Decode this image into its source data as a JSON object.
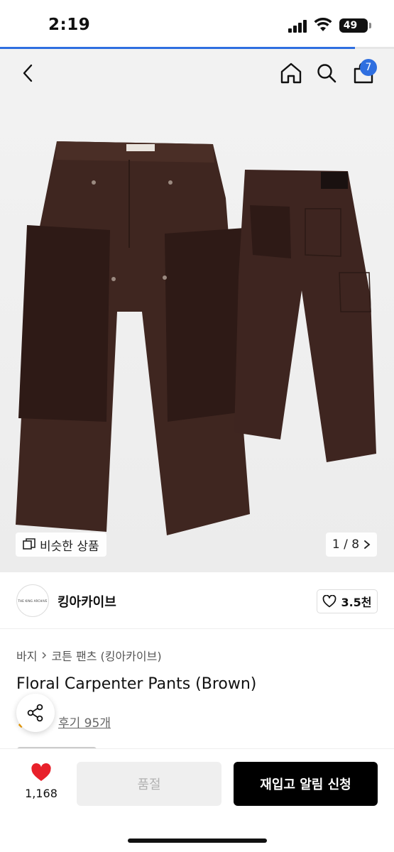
{
  "status_bar": {
    "time": "2:19",
    "battery": "49",
    "page_load_progress": 0.9
  },
  "nav": {
    "back_icon": "chevron-left-icon",
    "home_icon": "home-icon",
    "search_icon": "search-icon",
    "cart_icon": "shopping-bag-icon",
    "cart_count": "7",
    "accent_color": "#2f6fe0"
  },
  "gallery": {
    "similar_label": "비슷한 상품",
    "pager": "1 / 8",
    "product_color": "#3f2620"
  },
  "brand": {
    "logo_text": "THE KING ARCHIVE",
    "name": "킹아카이브",
    "likes": "3.5천"
  },
  "breadcrumb": {
    "category": "바지",
    "subcategory": "코튼 팬츠 (킹아카이브)"
  },
  "product": {
    "title": "Floral Carpenter Pants (Brown)",
    "reviews": "후기 95개"
  },
  "bottom_bar": {
    "like_count": "1,168",
    "soldout_label": "품절",
    "restock_label": "재입고 알림 신청",
    "heart_color": "#e8202a"
  }
}
